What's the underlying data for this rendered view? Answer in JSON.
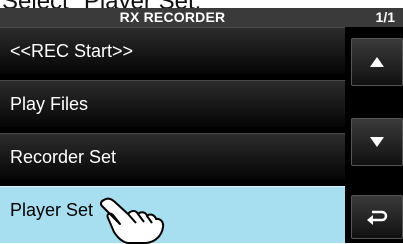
{
  "caption": "Select \"Player Set.\"",
  "screen": {
    "title": "RX RECORDER",
    "page": "1/1",
    "items": [
      {
        "label": "<<REC Start>>",
        "selected": false
      },
      {
        "label": "Play Files",
        "selected": false
      },
      {
        "label": "Recorder Set",
        "selected": false
      },
      {
        "label": "Player Set",
        "selected": true
      }
    ],
    "side_buttons": [
      {
        "icon": "up-arrow-icon"
      },
      {
        "icon": "down-arrow-icon"
      },
      {
        "icon": "return-icon"
      }
    ]
  },
  "colors": {
    "selected_bg": "#a8dff0",
    "item_bg": "#1a1a1a",
    "titlebar_bg": "#3a3a3a"
  }
}
